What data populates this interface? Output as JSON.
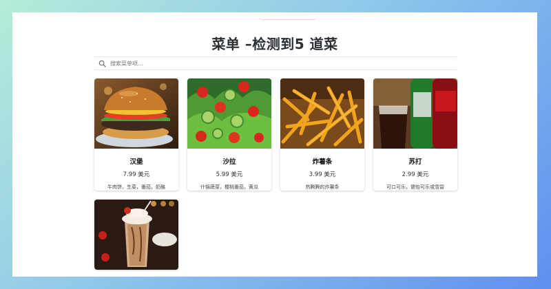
{
  "page": {
    "title": "菜单 –检测到5 道菜"
  },
  "search": {
    "placeholder": "搜索菜单项..."
  },
  "menu_items": [
    {
      "name": "汉堡",
      "price": "7.99 美元",
      "description": "牛肉饼，生菜，番茄，奶酪",
      "image": "burger"
    },
    {
      "name": "沙拉",
      "price": "5.99 美元",
      "description": "什锦蔬菜，樱桃番茄，黄瓜",
      "image": "salad"
    },
    {
      "name": "炸薯条",
      "price": "3.99 美元",
      "description": "热腾腾的炸薯条",
      "image": "fries"
    },
    {
      "name": "苏打",
      "price": "2.99 美元",
      "description": "可口可乐，健怡可乐或雪碧",
      "image": "soda"
    },
    {
      "name": "",
      "price": "",
      "description": "",
      "image": "milkshake"
    }
  ]
}
